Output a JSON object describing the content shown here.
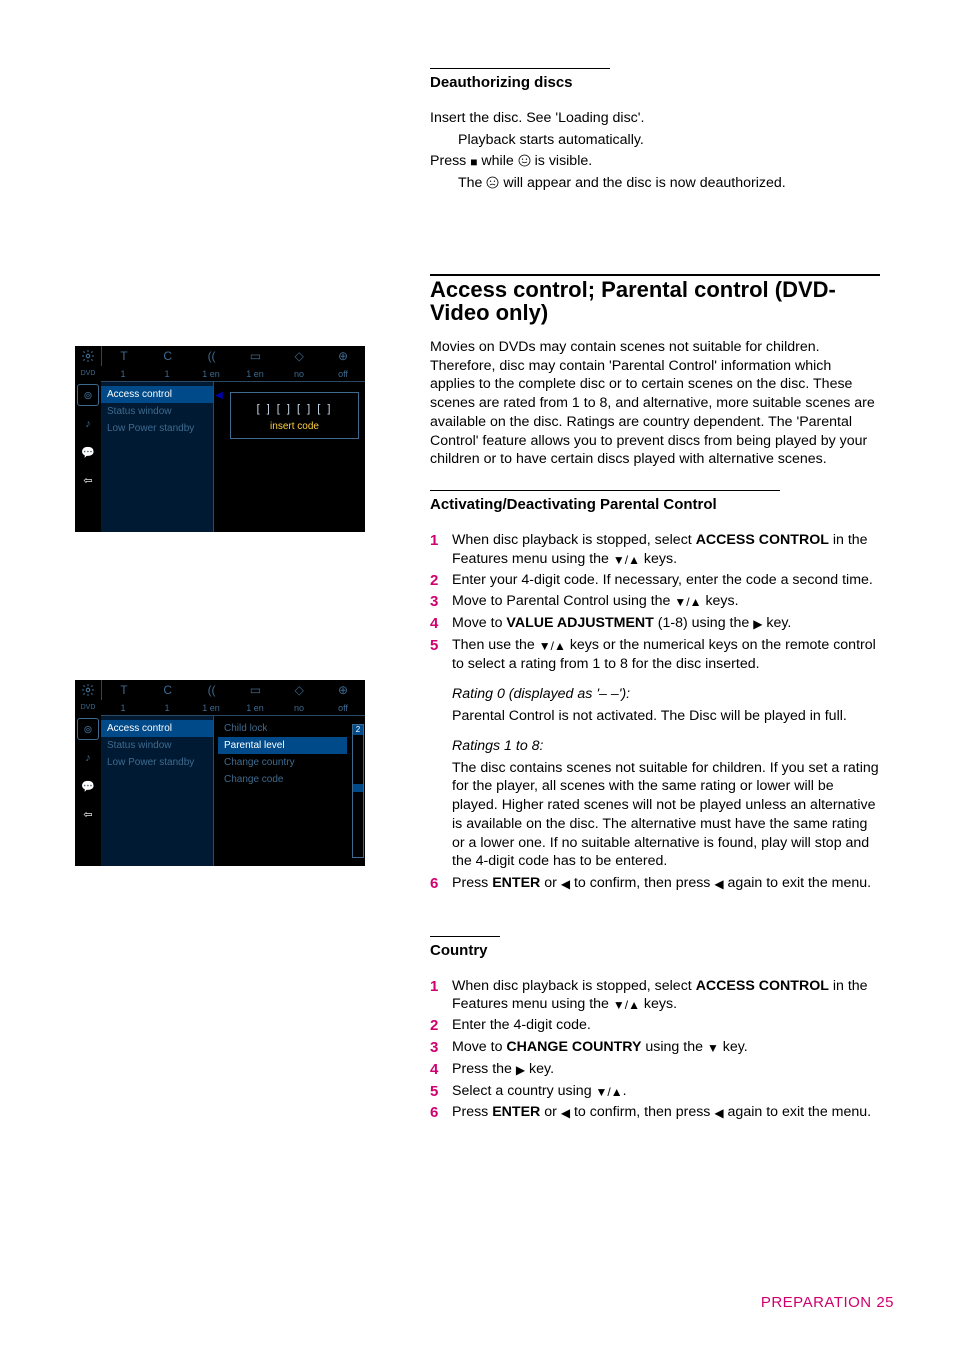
{
  "section_deauth": {
    "heading": "Deauthorizing discs",
    "p1": "Insert the disc. See 'Loading disc'.",
    "p1_sub": "Playback starts automatically.",
    "p2_a": "Press ",
    "p2_b": "  while ",
    "p2_c": " is visible.",
    "p2_sub_a": "The ",
    "p2_sub_b": " will appear and the disc is now deauthorized."
  },
  "section_access_control": {
    "heading": "Access control; Parental control (DVD-Video only)",
    "intro": "Movies on DVDs may contain scenes not suitable for children. Therefore, disc may contain 'Parental Control' information which applies to the complete disc or to certain scenes on the disc. These scenes are rated from 1 to 8, and alternative, more suitable scenes are available on the disc. Ratings are country dependent. The 'Parental Control' feature allows you to prevent discs from being played by your children or to have certain discs played with alternative scenes."
  },
  "section_activating": {
    "heading": "Activating/Deactivating Parental Control",
    "step1_a": "When disc playback is stopped, select ",
    "step1_bold": "ACCESS CONTROL",
    "step1_b": " in the Features menu using the ",
    "step1_c": " keys.",
    "step2": "Enter your 4-digit code. If necessary, enter the code a second time.",
    "step3_a": "Move to Parental Control using the ",
    "step3_b": "  keys.",
    "step4_a": "Move to ",
    "step4_bold": "VALUE ADJUSTMENT",
    "step4_b": " (1-8) using the ",
    "step4_c": "  key.",
    "step5_a": "Then use the ",
    "step5_b": " keys or the numerical keys on the remote control to select a rating from 1 to 8 for the disc inserted.",
    "rating0_title": "Rating 0 (displayed as '– –'):",
    "rating0_body": "Parental Control is not activated. The Disc will be played in full.",
    "rating18_title": "Ratings 1 to 8:",
    "rating18_body": "The disc contains scenes not suitable for children. If you set a rating for the player, all scenes with the same rating or lower will be played. Higher rated scenes will not be played unless an alternative is available on the disc. The alternative must have the same rating or a lower one. If no suitable alternative is found, play will stop and the 4-digit code has to be entered.",
    "step6_a": "Press ",
    "step6_bold": "ENTER",
    "step6_b": " or ",
    "step6_c": " to confirm, then press ",
    "step6_d": " again to exit the menu."
  },
  "section_country": {
    "heading": "Country",
    "step1_a": "When disc playback is stopped, select ",
    "step1_bold": "ACCESS CONTROL",
    "step1_b": " in the Features menu using the ",
    "step1_c": "  keys.",
    "step2": "Enter the 4-digit code.",
    "step3_a": "Move to ",
    "step3_bold": "CHANGE COUNTRY",
    "step3_b": " using the ",
    "step3_c": " key.",
    "step4_a": "Press the ",
    "step4_b": " key.",
    "step5_a": "Select a country using ",
    "step5_b": ".",
    "step6_a": "Press ",
    "step6_bold": "ENTER",
    "step6_b": " or ",
    "step6_c": " to confirm, then press ",
    "step6_d": " again to exit the menu."
  },
  "footer": {
    "label": "PREPARATION",
    "page": "25"
  },
  "osd_common": {
    "tabs": [
      "1",
      "1",
      "1 en",
      "1 en",
      "no",
      "off"
    ],
    "col1": [
      "Access control",
      "Status window",
      "Low Power standby"
    ]
  },
  "osd1": {
    "code_digits": "[ ] [ ] [ ] [ ]",
    "code_label": "insert code"
  },
  "osd2": {
    "col2": [
      "Child lock",
      "Parental level",
      "Change country",
      "Change code"
    ],
    "slider_top": "2"
  },
  "symbols": {
    "down_up": "▼/▲",
    "down": "▼",
    "right": "▶",
    "left": "◀",
    "stop": "■"
  }
}
